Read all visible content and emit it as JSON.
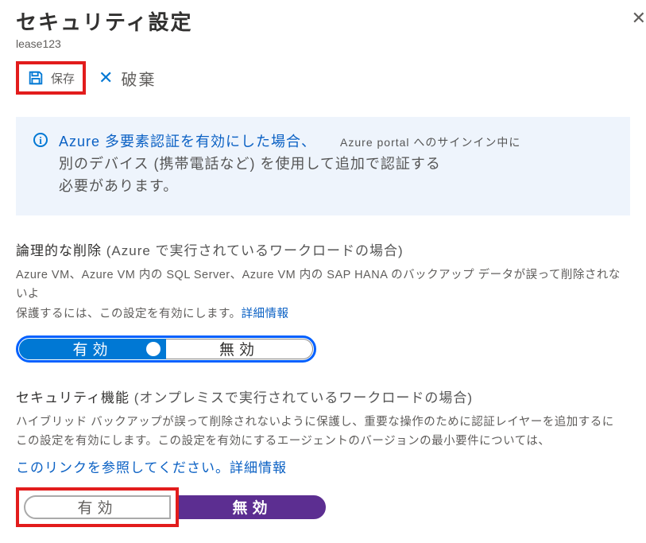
{
  "header": {
    "title": "セキュリティ設定",
    "subtitle": "lease123"
  },
  "toolbar": {
    "save_label": "保存",
    "discard_label": "破棄"
  },
  "info": {
    "part1_hl": "Azure 多要素認証を有効にした場合、",
    "side_note": "Azure portal へのサインイン中に",
    "line2": "別のデバイス (携帯電話など) を使用して追加で認証する",
    "line3": "必要があります。"
  },
  "section1": {
    "title_main": "論理的な削除 ",
    "title_paren": "(Azure で実行されているワークロードの場合)",
    "desc_line1": "Azure VM、Azure VM 内の SQL Server、Azure VM 内の SAP HANA のバックアップ データが誤って削除されないよ",
    "desc_line2_a": "保護するには、この設定を有効にします。",
    "desc_line2_link": "詳細情報",
    "enable": "有効",
    "disable": "無効"
  },
  "section2": {
    "title_main": "セキュリティ機能 ",
    "title_paren": "(オンプレミスで実行されているワークロードの場合)",
    "desc_line1": "ハイブリッド バックアップが誤って削除されないように保護し、重要な操作のために認証レイヤーを追加するに",
    "desc_line2": "この設定を有効にします。この設定を有効にするエージェントのバージョンの最小要件については、",
    "link_line": "このリンクを参照してください。詳細情報",
    "enable": "有効",
    "disable": "無効"
  }
}
